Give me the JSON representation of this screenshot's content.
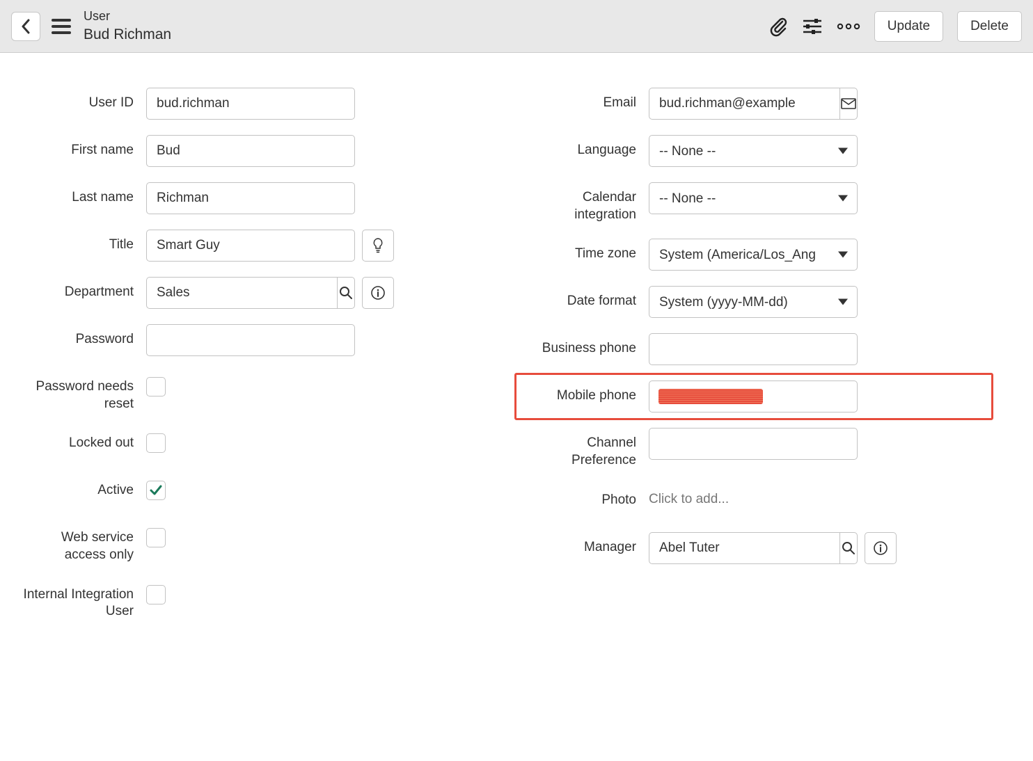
{
  "header": {
    "type_label": "User",
    "record_name": "Bud Richman",
    "update_label": "Update",
    "delete_label": "Delete"
  },
  "left": {
    "user_id": {
      "label": "User ID",
      "value": "bud.richman"
    },
    "first_name": {
      "label": "First name",
      "value": "Bud"
    },
    "last_name": {
      "label": "Last name",
      "value": "Richman"
    },
    "title": {
      "label": "Title",
      "value": "Smart Guy"
    },
    "department": {
      "label": "Department",
      "value": "Sales"
    },
    "password": {
      "label": "Password",
      "value": ""
    },
    "password_reset": {
      "label": "Password needs reset",
      "checked": false
    },
    "locked_out": {
      "label": "Locked out",
      "checked": false
    },
    "active": {
      "label": "Active",
      "checked": true
    },
    "web_service": {
      "label": "Web service access only",
      "checked": false
    },
    "internal_integration": {
      "label": "Internal Integration User",
      "checked": false
    }
  },
  "right": {
    "email": {
      "label": "Email",
      "value": "bud.richman@example"
    },
    "language": {
      "label": "Language",
      "value": "-- None --"
    },
    "calendar": {
      "label": "Calendar integration",
      "value": "-- None --"
    },
    "timezone": {
      "label": "Time zone",
      "value": "System (America/Los_Ang"
    },
    "date_format": {
      "label": "Date format",
      "value": "System (yyyy-MM-dd)"
    },
    "business_phone": {
      "label": "Business phone",
      "value": ""
    },
    "mobile_phone": {
      "label": "Mobile phone",
      "value": ""
    },
    "channel_pref": {
      "label": "Channel Preference",
      "value": ""
    },
    "photo": {
      "label": "Photo",
      "placeholder": "Click to add..."
    },
    "manager": {
      "label": "Manager",
      "value": "Abel Tuter"
    }
  }
}
